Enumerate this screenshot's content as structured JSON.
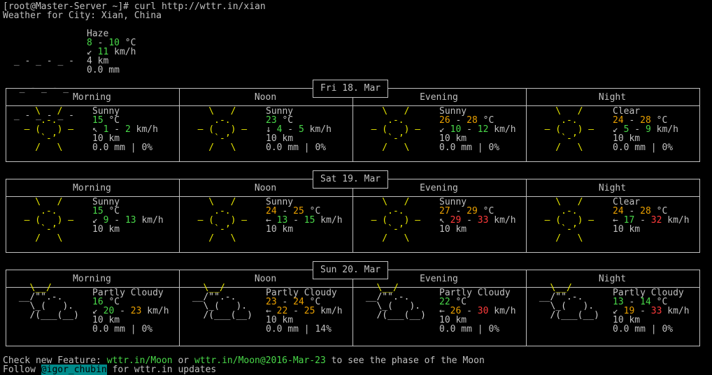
{
  "terminal": {
    "prompt": "[root@Master-Server ~]# curl http://wttr.in/xian",
    "location": "Weather for City: Xian, China"
  },
  "current": {
    "condition": "Haze",
    "temp_a": "8",
    "temp_b": "10",
    "temp_unit": "°C",
    "wind_arrow": "↙",
    "wind": "11",
    "wind_unit": "km/h",
    "visibility": "4 km",
    "precip": "0.0 mm",
    "icon_lines": [
      " _ - _ - _ -",
      "  _ - _ - _",
      " _ - _ - _ -"
    ]
  },
  "periods": [
    "Morning",
    "Noon",
    "Evening",
    "Night"
  ],
  "days": [
    {
      "date": "Fri 18. Mar",
      "cells": [
        {
          "cond": "Sunny",
          "t": [
            {
              "v": "15",
              "c": "g"
            }
          ],
          "unit": "°C",
          "arrow": "↖",
          "w": [
            {
              "v": "1",
              "c": "g"
            },
            {
              "v": "2",
              "c": "g"
            }
          ],
          "wunit": "km/h",
          "vis": "10 km",
          "precip": "0.0 mm | 0%",
          "icon": "sun"
        },
        {
          "cond": "Sunny",
          "t": [
            {
              "v": "23",
              "c": "g"
            }
          ],
          "unit": "°C",
          "arrow": "↓",
          "w": [
            {
              "v": "4",
              "c": "g"
            },
            {
              "v": "5",
              "c": "g"
            }
          ],
          "wunit": "km/h",
          "vis": "10 km",
          "precip": "0.0 mm | 0%",
          "icon": "sun"
        },
        {
          "cond": "Sunny",
          "t": [
            {
              "v": "26",
              "c": "o"
            },
            {
              "v": "28",
              "c": "o"
            }
          ],
          "unit": "°C",
          "arrow": "↙",
          "w": [
            {
              "v": "10",
              "c": "g"
            },
            {
              "v": "12",
              "c": "g"
            }
          ],
          "wunit": "km/h",
          "vis": "10 km",
          "precip": "0.0 mm | 0%",
          "icon": "sun"
        },
        {
          "cond": "Clear",
          "t": [
            {
              "v": "24",
              "c": "o"
            },
            {
              "v": "28",
              "c": "o"
            }
          ],
          "unit": "°C",
          "arrow": "↙",
          "w": [
            {
              "v": "5",
              "c": "g"
            },
            {
              "v": "9",
              "c": "g"
            }
          ],
          "wunit": "km/h",
          "vis": "10 km",
          "precip": "0.0 mm | 0%",
          "icon": "sun"
        }
      ]
    },
    {
      "date": "Sat 19. Mar",
      "cells": [
        {
          "cond": "Sunny",
          "t": [
            {
              "v": "15",
              "c": "g"
            }
          ],
          "unit": "°C",
          "arrow": "↙",
          "w": [
            {
              "v": "9",
              "c": "g"
            },
            {
              "v": "13",
              "c": "g"
            }
          ],
          "wunit": "km/h",
          "vis": "10 km",
          "precip": "",
          "icon": "sun"
        },
        {
          "cond": "Sunny",
          "t": [
            {
              "v": "24",
              "c": "o"
            },
            {
              "v": "25",
              "c": "o"
            }
          ],
          "unit": "°C",
          "arrow": "←",
          "w": [
            {
              "v": "13",
              "c": "g"
            },
            {
              "v": "15",
              "c": "g"
            }
          ],
          "wunit": "km/h",
          "vis": "10 km",
          "precip": "",
          "icon": "sun"
        },
        {
          "cond": "Sunny",
          "t": [
            {
              "v": "27",
              "c": "o"
            },
            {
              "v": "29",
              "c": "o"
            }
          ],
          "unit": "°C",
          "arrow": "↖",
          "w": [
            {
              "v": "29",
              "c": "r"
            },
            {
              "v": "33",
              "c": "r"
            }
          ],
          "wunit": "km/h",
          "vis": "10 km",
          "precip": "",
          "icon": "sun"
        },
        {
          "cond": "Clear",
          "t": [
            {
              "v": "24",
              "c": "o"
            },
            {
              "v": "28",
              "c": "o"
            }
          ],
          "unit": "°C",
          "arrow": "←",
          "w": [
            {
              "v": "17",
              "c": "g"
            },
            {
              "v": "32",
              "c": "r"
            }
          ],
          "wunit": "km/h",
          "vis": "10 km",
          "precip": "",
          "icon": "sun"
        }
      ]
    },
    {
      "date": "Sun 20. Mar",
      "cells": [
        {
          "cond": "Partly Cloudy",
          "t": [
            {
              "v": "16",
              "c": "g"
            }
          ],
          "unit": "°C",
          "arrow": "↙",
          "w": [
            {
              "v": "20",
              "c": "g"
            },
            {
              "v": "23",
              "c": "o"
            }
          ],
          "wunit": "km/h",
          "vis": "10 km",
          "precip": "0.0 mm | 0%",
          "icon": "cloud"
        },
        {
          "cond": "Partly Cloudy",
          "t": [
            {
              "v": "23",
              "c": "o"
            },
            {
              "v": "24",
              "c": "o"
            }
          ],
          "unit": "°C",
          "arrow": "←",
          "w": [
            {
              "v": "22",
              "c": "o"
            },
            {
              "v": "25",
              "c": "o"
            }
          ],
          "wunit": "km/h",
          "vis": "10 km",
          "precip": "0.0 mm | 14%",
          "icon": "cloud"
        },
        {
          "cond": "Partly Cloudy",
          "t": [
            {
              "v": "22",
              "c": "g"
            }
          ],
          "unit": "°C",
          "arrow": "←",
          "w": [
            {
              "v": "26",
              "c": "o"
            },
            {
              "v": "30",
              "c": "r"
            }
          ],
          "wunit": "km/h",
          "vis": "10 km",
          "precip": "0.0 mm | 0%",
          "icon": "cloud"
        },
        {
          "cond": "Partly Cloudy",
          "t": [
            {
              "v": "13",
              "c": "g"
            },
            {
              "v": "14",
              "c": "g"
            }
          ],
          "unit": "°C",
          "arrow": "↙",
          "w": [
            {
              "v": "19",
              "c": "o"
            },
            {
              "v": "33",
              "c": "r"
            }
          ],
          "wunit": "km/h",
          "vis": "10 km",
          "precip": "0.0 mm | 0%",
          "icon": "cloud"
        }
      ]
    }
  ],
  "icons": {
    "sun": [
      "    \\   /    ",
      "     .-.     ",
      "  ‒ (   ) ‒  ",
      "     `-’     ",
      "    /   \\    "
    ],
    "cloud": [
      "   \\__/      ",
      " __/\"\".-.    ",
      "   \\_(   ).  ",
      "   /(___(__) "
    ]
  },
  "footer": {
    "line1_a": "Check new Feature: ",
    "link1": "wttr.in/Moon",
    "line1_b": " or ",
    "link2": "wttr.in/Moon@2016-Mar-23",
    "line1_c": " to see the phase of the Moon",
    "line2_a": "Follow ",
    "handle": "@igor_chubin",
    "line2_b": " for wttr.in updates"
  },
  "colors": {
    "green": "#49d849",
    "orange": "#e9a000",
    "red": "#ff3b3b",
    "yellow": "#e5e500",
    "cyan": "#008b8b"
  }
}
